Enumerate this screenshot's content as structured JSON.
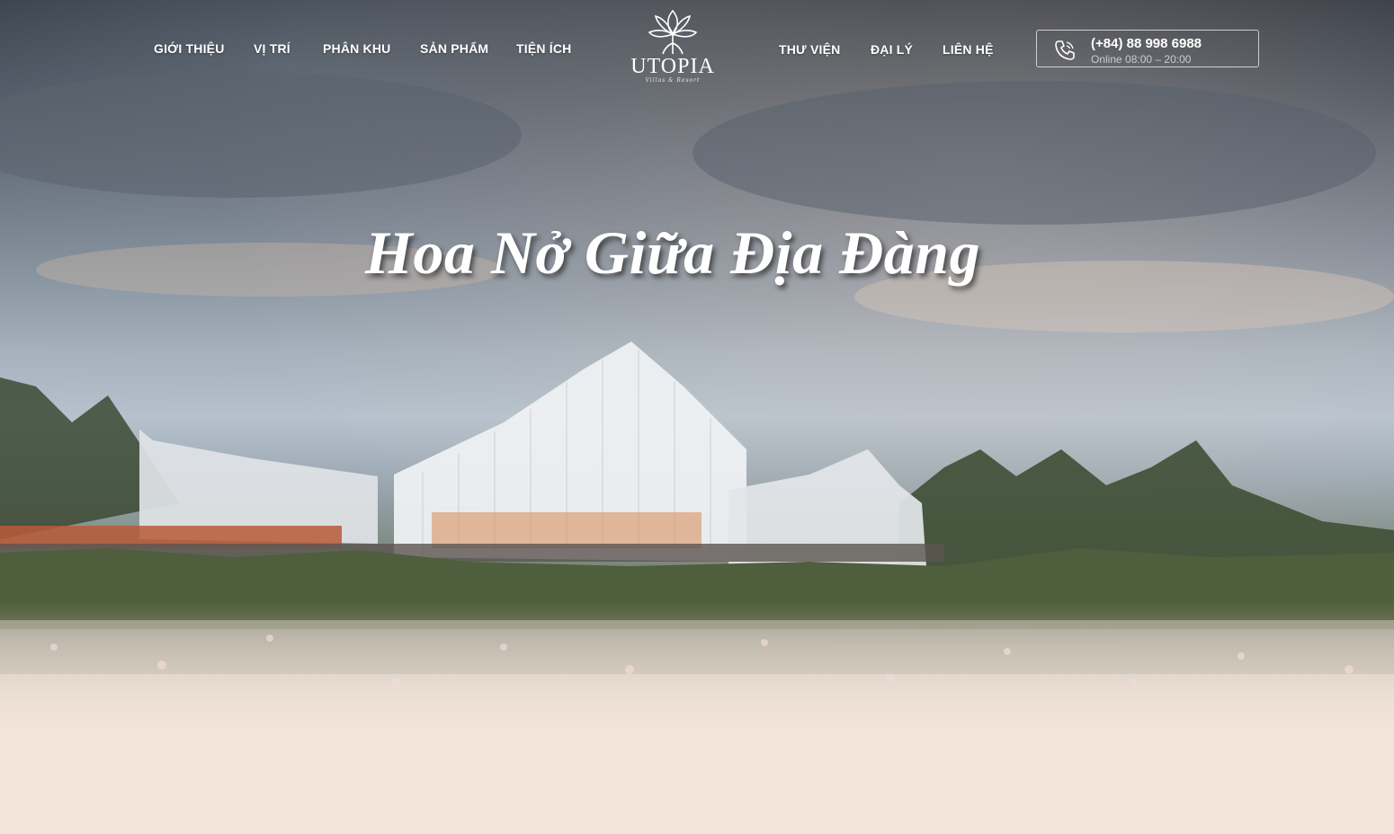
{
  "nav_left": [
    {
      "label": "GIỚI THIỆU"
    },
    {
      "label": "VỊ TRÍ"
    },
    {
      "label": "PHÂN KHU"
    },
    {
      "label": "SẢN PHẨM"
    },
    {
      "label": "TIỆN ÍCH"
    }
  ],
  "nav_right": [
    {
      "label": "THƯ VIỆN"
    },
    {
      "label": "ĐẠI LÝ"
    },
    {
      "label": "LIÊN HỆ"
    }
  ],
  "logo": {
    "name": "UTOPIA",
    "tagline": "Villas & Resort",
    "icon": "lotus-logo-icon"
  },
  "contact": {
    "phone": "(+84) 88 998 6988",
    "hours": "Online 08:00 – 20:00",
    "icon": "phone-icon"
  },
  "hero": {
    "headline": "Hoa Nở Giữa Địa Đàng"
  },
  "colors": {
    "sky_top": "#2a313c",
    "sky_mid": "#a6b3bf",
    "foliage": "#4f5e3c",
    "water_fade": "#f2e4d8",
    "text": "#ffffff"
  }
}
